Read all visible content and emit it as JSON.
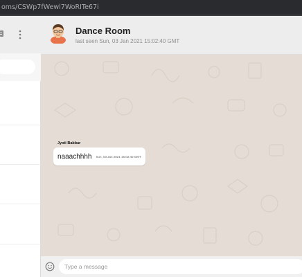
{
  "browser": {
    "url_fragment": "oms/CSWp7fWewl7WoRITe67i"
  },
  "chat": {
    "room_name": "Dance Room",
    "last_seen": "last seen Sun, 03 Jan 2021 15:02:40 GMT",
    "messages": [
      {
        "sender": "Jyoti Babbar",
        "text": "naaachhhh",
        "timestamp": "Sun, 03 Jan 2021 15:02:40 GMT"
      }
    ]
  },
  "composer": {
    "placeholder": "Type a message"
  },
  "colors": {
    "chat_background": "#e5ddd5",
    "header_background": "#ededed",
    "bubble_background": "#ffffff"
  }
}
